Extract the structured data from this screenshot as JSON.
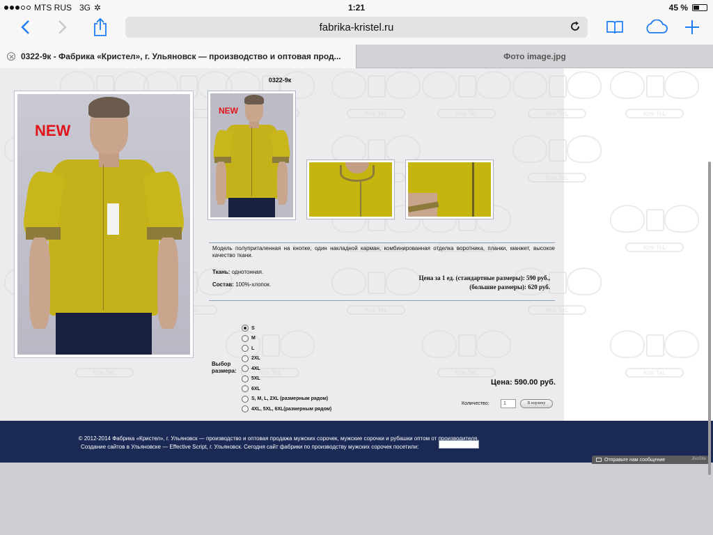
{
  "status": {
    "carrier": "MTS RUS",
    "network": "3G",
    "time": "1:21",
    "battery_text": "45 %",
    "battery_level": 0.45
  },
  "browser": {
    "url": "fabrika-kristel.ru",
    "tabs": [
      {
        "label": "0322-9к - Фабрика «Кристел», г. Ульяновск — производство и оптовая прод..."
      },
      {
        "label": "Фото image.jpg"
      }
    ],
    "icons": {
      "back": "back-arrow-icon",
      "forward": "forward-arrow-icon",
      "share": "share-icon",
      "reload": "reload-icon",
      "bookmarks": "book-icon",
      "cloud": "icloud-icon",
      "new_tab": "plus-icon"
    },
    "accent": "#1a7cf5"
  },
  "product": {
    "title": "0322-9к",
    "new_badge": "NEW",
    "description": "Модель полуприталенная на кнопке, один накладной карман, комбинированная отделка воротника, планки, манжет, высокое качество ткани.",
    "fabric_label": "Ткань:",
    "fabric_value": "однотонная.",
    "composition_label": "Состав:",
    "composition_value": "100%-хлопок.",
    "price_standard": "Цена за 1 ед. (стандартные размеры): 590 руб.,",
    "price_large": "(большие размеры): 620 руб.",
    "size_label": "Выбор размера:",
    "sizes": [
      "S",
      "M",
      "L",
      "2XL",
      "4XL",
      "5XL",
      "6XL",
      "S, M, L, 2XL (размерным рядом)",
      "4XL, 5XL, 6XL(размерным рядом)"
    ],
    "selected_size": "S",
    "total_price": "Цена: 590.00 руб.",
    "qty_label": "Количество:",
    "qty_value": "1",
    "cart_button": "В корзину",
    "watermark": "Kris TeL",
    "shirt_color": "#c5b21a"
  },
  "footer": {
    "line1": "© 2012-2014 Фабрика «Кристел», г. Ульяновск — производство и оптовая продажа мужских сорочек, мужские сорочки и рубашки оптом от производителя.",
    "line2": "Создание сайтов в Ульяновске — Effective Script, г. Ульяновск. Сегодня сайт фабрики по производству мужских сорочек посетили:",
    "feedback": "Отправьте нам сообщение",
    "feedback_brand": "JivoSite",
    "bg": "#1b2a54"
  }
}
